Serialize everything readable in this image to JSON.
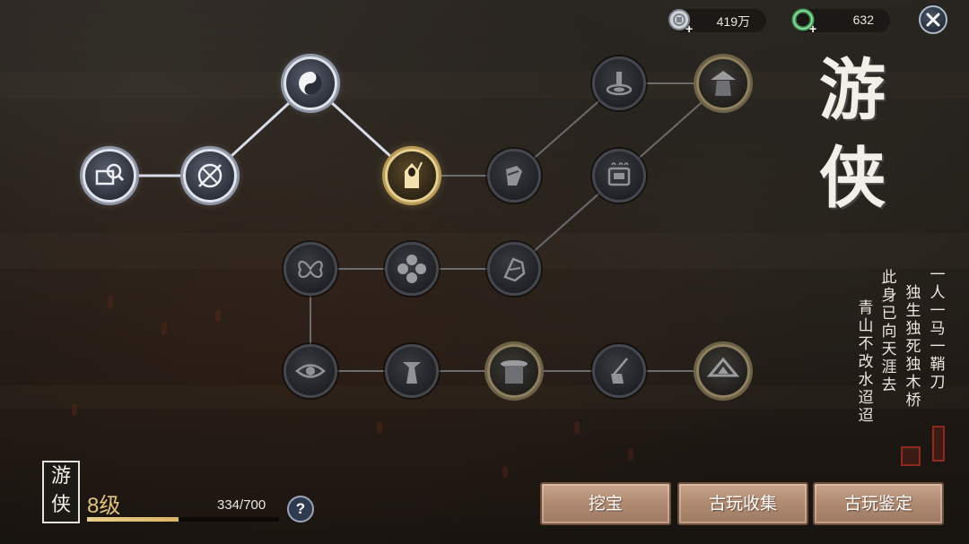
{
  "resources": {
    "silver": {
      "icon": "silver-coin-plus-icon",
      "value": "419万"
    },
    "jade": {
      "icon": "jade-ring-plus-icon",
      "value": "632"
    }
  },
  "close": {
    "icon": "close-icon"
  },
  "title": {
    "line1": "游",
    "line2": "侠"
  },
  "poem": {
    "col1": "一人一马一鞘刀",
    "col2": "独生独死独木桥",
    "col3": "此身已向天涯去",
    "col4": "青山不改水迢迢"
  },
  "badge": {
    "line1": "游",
    "line2": "侠"
  },
  "level": {
    "label": "8级",
    "xp_text": "334/700",
    "xp_current": 334,
    "xp_max": 700
  },
  "help": {
    "label": "?"
  },
  "buttons": {
    "dig": "挖宝",
    "collect": "古玩收集",
    "appraise": "古玩鉴定"
  },
  "skill_tree": {
    "nodes": [
      {
        "id": "search",
        "icon": "search-chest-icon",
        "state": "active"
      },
      {
        "id": "compass",
        "icon": "compass-swords-icon",
        "state": "active"
      },
      {
        "id": "taiji",
        "icon": "yin-yang-icon",
        "state": "active"
      },
      {
        "id": "wanderer",
        "icon": "hooded-swordsman-icon",
        "state": "selected"
      },
      {
        "id": "arm",
        "icon": "armored-arm-icon",
        "state": "locked"
      },
      {
        "id": "fountain",
        "icon": "fountain-icon",
        "state": "locked"
      },
      {
        "id": "bamboo-hat",
        "icon": "bamboo-hat-warrior-icon",
        "state": "locked-bronze"
      },
      {
        "id": "cauldron",
        "icon": "cauldron-icon",
        "state": "locked"
      },
      {
        "id": "butterfly",
        "icon": "butterfly-icon",
        "state": "locked"
      },
      {
        "id": "shuriken",
        "icon": "cross-emblem-icon",
        "state": "locked"
      },
      {
        "id": "gauntlet",
        "icon": "gauntlet-icon",
        "state": "locked"
      },
      {
        "id": "eye",
        "icon": "eye-icon",
        "state": "locked"
      },
      {
        "id": "robed",
        "icon": "robed-figure-icon",
        "state": "locked"
      },
      {
        "id": "veiled",
        "icon": "veiled-hat-icon",
        "state": "locked-bronze"
      },
      {
        "id": "blade-hand",
        "icon": "hand-blade-icon",
        "state": "locked"
      },
      {
        "id": "straw-hat",
        "icon": "straw-hat-icon",
        "state": "locked-bronze"
      }
    ]
  }
}
